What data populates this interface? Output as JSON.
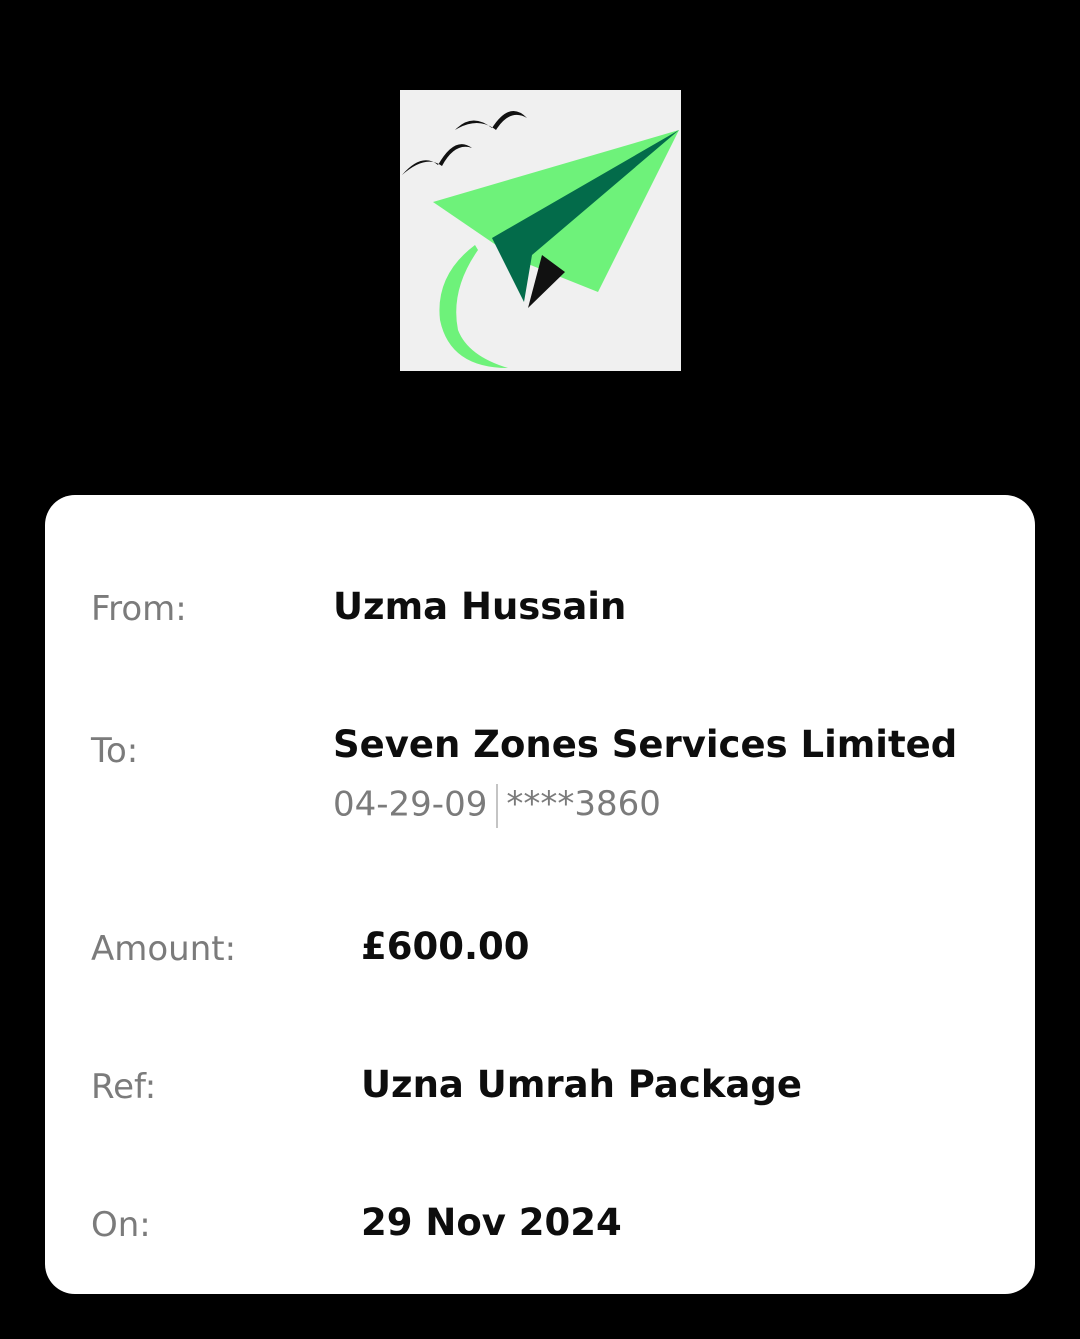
{
  "logo": {
    "icon": "paper-plane-logo-icon",
    "colors": {
      "light_green": "#6ef27a",
      "dark_green": "#036b4a",
      "background": "#f0f0f0"
    }
  },
  "payment": {
    "from_label": "From:",
    "from_value": "Uzma Hussain",
    "to_label": "To:",
    "to_value": "Seven Zones Services Limited",
    "sort_code": "04-29-09",
    "account_masked": "****3860",
    "amount_label": "Amount:",
    "amount_value": "£600.00",
    "ref_label": "Ref:",
    "ref_value": "Uzna Umrah Package",
    "on_label": "On:",
    "on_value": "29 Nov 2024"
  }
}
